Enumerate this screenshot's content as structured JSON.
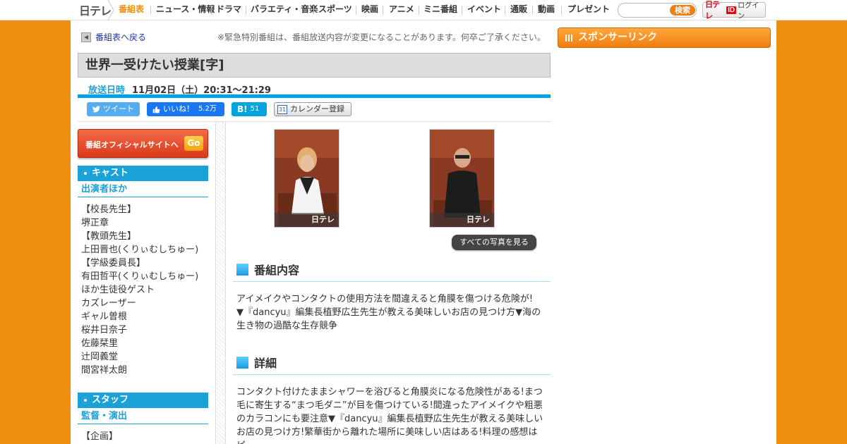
{
  "header": {
    "logo": "日テレ",
    "nav": [
      {
        "label": "番組表",
        "active": true
      },
      {
        "label": "ニュース・情報"
      },
      {
        "label": "ドラマ"
      },
      {
        "label": "バラエティ・音楽"
      },
      {
        "label": "スポーツ"
      },
      {
        "label": "映画"
      },
      {
        "label": "アニメ"
      },
      {
        "label": "ミニ番組"
      },
      {
        "label": "イベント"
      },
      {
        "label": "通販"
      },
      {
        "label": "動画"
      },
      {
        "label": "プレゼント"
      }
    ],
    "search_value": "",
    "search_button": "検索",
    "login": {
      "logo": "日テレ",
      "id_badge": "ID",
      "label": "ログイン"
    }
  },
  "back_link": "番組表へ戻る",
  "notice": "※緊急特別番組は、番組放送内容が変更になることがあります。何卒ご了承ください。",
  "program": {
    "title": "世界一受けたい授業[字]",
    "air_label": "放送日時",
    "air_value": "11月02日（土）20:31～21:29"
  },
  "share": {
    "tweet": "ツイート",
    "like": "いいね！",
    "like_count": "5.2万",
    "hatena": "B!",
    "hatena_count": "51",
    "calendar_icon": "31",
    "calendar": "カレンダー登録"
  },
  "official_button": {
    "label": "番組オフィシャルサイトへ",
    "go": "Go"
  },
  "cast_section": {
    "heading": "キャスト",
    "subheading": "出演者ほか",
    "items": [
      "【校長先生】",
      "堺正章",
      "【教頭先生】",
      "上田晋也(くりぃむしちゅー)",
      "【学級委員長】",
      "有田哲平(くりぃむしちゅー)",
      "ほか生徒役ゲスト",
      "カズレーザー",
      "ギャル曽根",
      "桜井日奈子",
      "佐藤栞里",
      "辻岡義堂",
      "間宮祥太朗"
    ]
  },
  "staff_section": {
    "heading": "スタッフ",
    "subheading": "監督・演出",
    "items": [
      "【企画】"
    ]
  },
  "photos": {
    "watermark": "日テレ",
    "all_button": "すべての写真を見る"
  },
  "content_section": {
    "heading": "番組内容",
    "lines": [
      "アイメイクやコンタクトの使用方法を間違えると角膜を傷つける危険が!",
      "▼『dancyu』編集長植野広生先生が教える美味しいお店の見つけ方▼海の",
      "生き物の過酷な生存競争"
    ]
  },
  "detail_section": {
    "heading": "詳細",
    "lines": [
      "コンタクト付けたままシャワーを浴びると角膜炎になる危険性がある!まつ",
      "毛に寄生する“まつ毛ダニ”が目を傷つけている!間違ったアイメイクや粗悪",
      "のカラコンにも要注意▼『dancyu』編集長植野広生先生が教える美味しい",
      "お店の見つけ方!繁華街から離れた場所に美味しい店はある!料理の感想はピ"
    ]
  },
  "sidebar": {
    "sponsor_heading": "スポンサーリンク"
  },
  "colors": {
    "brand_orange": "#ef8f12",
    "accent_blue": "#1aa1d8"
  }
}
